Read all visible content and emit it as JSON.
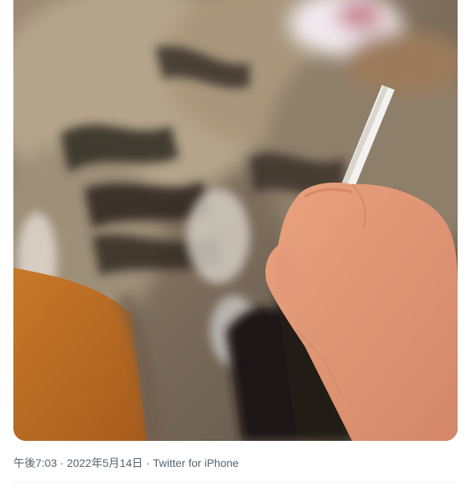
{
  "tweet": {
    "media": {
      "kind": "photo",
      "icon": "photo-media"
    },
    "meta": {
      "time": "午後7:03",
      "separator": "·",
      "date": "2022年5月14日",
      "source": "Twitter for iPhone"
    }
  },
  "colors": {
    "meta_text": "#536471",
    "divider": "#eff3f4",
    "background": "#ffffff"
  }
}
